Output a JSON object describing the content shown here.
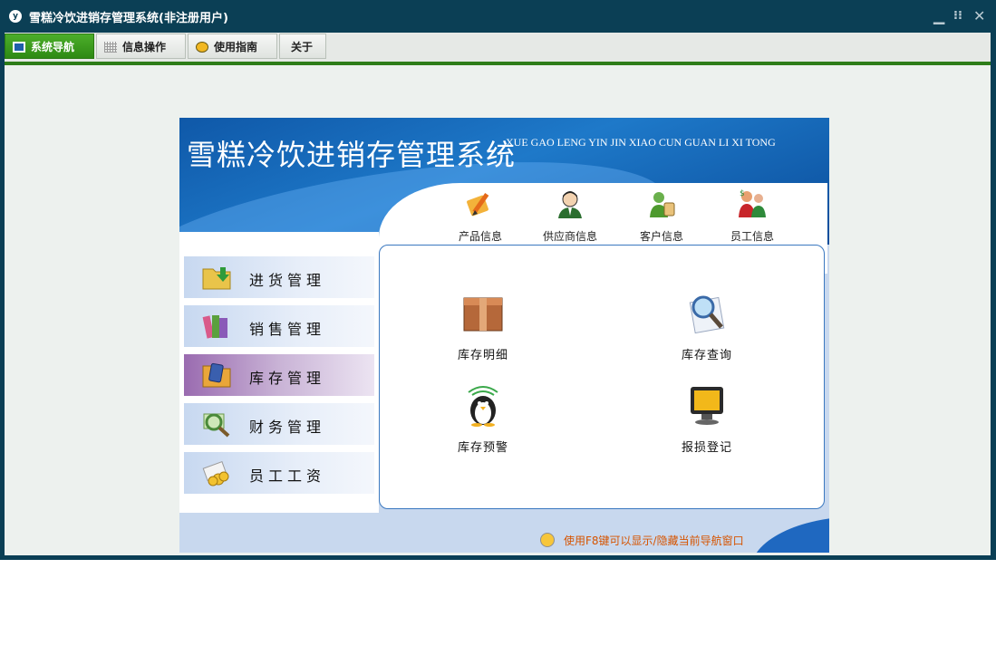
{
  "window": {
    "title": "雪糕冷饮进销存管理系统(非注册用户)",
    "app_icon_text": "y",
    "controls": {
      "minimize": "▁",
      "restore": "⁝⁝",
      "close": "✕"
    }
  },
  "tabs": [
    {
      "label": "系统导航",
      "icon": "monitor-icon",
      "active": true
    },
    {
      "label": "信息操作",
      "icon": "grid-icon",
      "active": false
    },
    {
      "label": "使用指南",
      "icon": "compass-icon",
      "active": false
    },
    {
      "label": "关于",
      "icon": "",
      "active": false
    }
  ],
  "banner": {
    "title": "雪糕冷饮进销存管理系统",
    "pinyin": "XUE GAO LENG YIN JIN XIAO CUN GUAN LI XI TONG"
  },
  "top_icons": [
    {
      "label": "产品信息",
      "icon": "product-pencil-icon"
    },
    {
      "label": "供应商信息",
      "icon": "supplier-person-icon"
    },
    {
      "label": "客户信息",
      "icon": "customer-person-icon"
    },
    {
      "label": "员工信息",
      "icon": "staff-people-icon"
    }
  ],
  "menu": [
    {
      "label": "进货管理",
      "icon": "purchase-folder-icon",
      "selected": false
    },
    {
      "label": "销售管理",
      "icon": "sales-books-icon",
      "selected": false
    },
    {
      "label": "库存管理",
      "icon": "inventory-folder-icon",
      "selected": true
    },
    {
      "label": "财务管理",
      "icon": "finance-magnifier-icon",
      "selected": false
    },
    {
      "label": "员工工资",
      "icon": "salary-coins-icon",
      "selected": false
    }
  ],
  "features": [
    {
      "label": "库存明细",
      "icon": "stock-box-icon"
    },
    {
      "label": "库存查询",
      "icon": "stock-search-icon"
    },
    {
      "label": "库存预警",
      "icon": "stock-alert-penguin-icon"
    },
    {
      "label": "报损登记",
      "icon": "loss-monitor-icon"
    }
  ],
  "hint": "使用F8键可以显示/隐藏当前导航窗口",
  "colors": {
    "window_frame": "#0b3f55",
    "tab_active": "#2e8a14",
    "banner_blue": "#1e79c9",
    "selected_menu": "#9a6bb0",
    "hint_text": "#d65400"
  }
}
